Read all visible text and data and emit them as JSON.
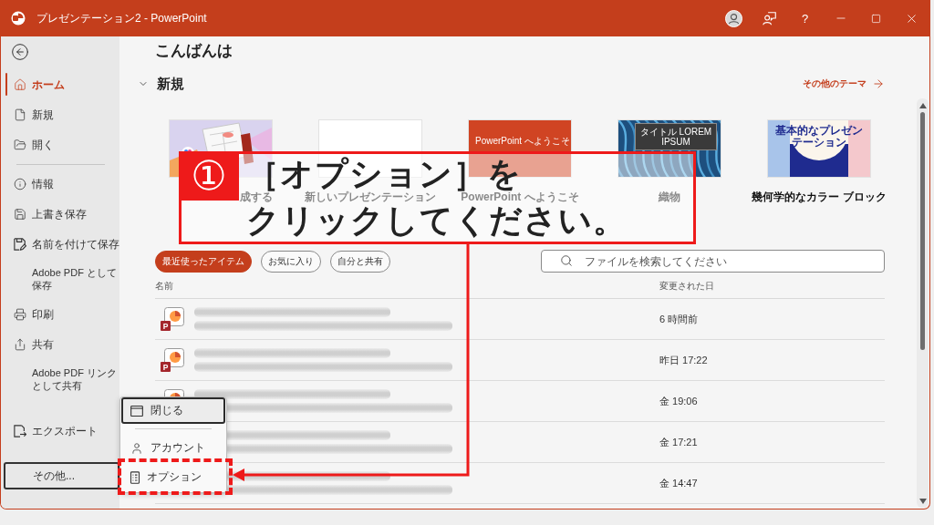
{
  "window": {
    "title": "プレゼンテーション2 - PowerPoint",
    "help_button": "?"
  },
  "sidebar": {
    "sections": [
      {
        "items": [
          {
            "label": "ホーム",
            "kind": "icon",
            "selected": true
          },
          {
            "label": "新規",
            "kind": "icon",
            "selected": false
          },
          {
            "label": "開く",
            "kind": "icon",
            "selected": false
          }
        ]
      },
      {
        "items": [
          {
            "label": "情報",
            "kind": "icon",
            "selected": false
          },
          {
            "label": "上書き保存",
            "kind": "icon",
            "selected": false
          },
          {
            "label": "名前を付けて保存",
            "kind": "icon",
            "selected": false
          },
          {
            "label": "Adobe PDF として保存",
            "kind": "text",
            "selected": false
          },
          {
            "label": "印刷",
            "kind": "icon",
            "selected": false
          },
          {
            "label": "共有",
            "kind": "icon",
            "selected": false
          },
          {
            "label": "Adobe PDF リンクとして共有",
            "kind": "text",
            "selected": false
          }
        ]
      }
    ],
    "bottom_items": [
      {
        "label": "エクスポート",
        "kind": "icon",
        "selected": false
      }
    ],
    "more_button": {
      "label": "その他...",
      "expanded": true
    }
  },
  "greeting": "こんばんは",
  "new_section": {
    "title": "新規",
    "expanded": true,
    "more_link": "その他のテーマ",
    "templates": [
      {
        "kind": "designer",
        "label": "成する"
      },
      {
        "kind": "blank",
        "label": "新しいプレゼンテーション"
      },
      {
        "kind": "welcome",
        "label": "PowerPoint へようこそ",
        "slide_title": "PowerPoint へようこそ"
      },
      {
        "kind": "woven",
        "label": "織物",
        "slide_title": "タイトル LOREM IPSUM"
      },
      {
        "kind": "geometric",
        "label": "幾何学的なカラー ブロック",
        "slide_title": "基本的なプレゼンテーション"
      }
    ]
  },
  "filters": [
    {
      "label": "最近使ったアイテム",
      "selected": true
    },
    {
      "label": "お気に入り",
      "selected": false
    },
    {
      "label": "自分と共有",
      "selected": false
    }
  ],
  "search": {
    "placeholder": "ファイルを検索してください"
  },
  "file_table": {
    "columns": [
      "名前",
      "変更された日"
    ],
    "rows": [
      {
        "kind": "presentation",
        "icon_badge": "P",
        "modified": "6 時間前"
      },
      {
        "kind": "presentation",
        "icon_badge": "P",
        "modified": "昨日 17:22"
      },
      {
        "kind": "presentation",
        "modified": "金 19:06"
      },
      {
        "modified": "金 17:21"
      },
      {
        "modified": "金 14:47"
      }
    ]
  },
  "menu": {
    "sections": [
      {
        "items": [
          {
            "label": "閉じる",
            "focused": true,
            "highlighted": false
          }
        ]
      },
      {
        "items": [
          {
            "label": "アカウント",
            "focused": false,
            "highlighted": false
          },
          {
            "label": "オプション",
            "focused": false,
            "highlighted": true
          }
        ]
      }
    ]
  },
  "callout": {
    "number": "①",
    "lines": [
      "［オプション］を",
      "クリックしてください。"
    ]
  }
}
